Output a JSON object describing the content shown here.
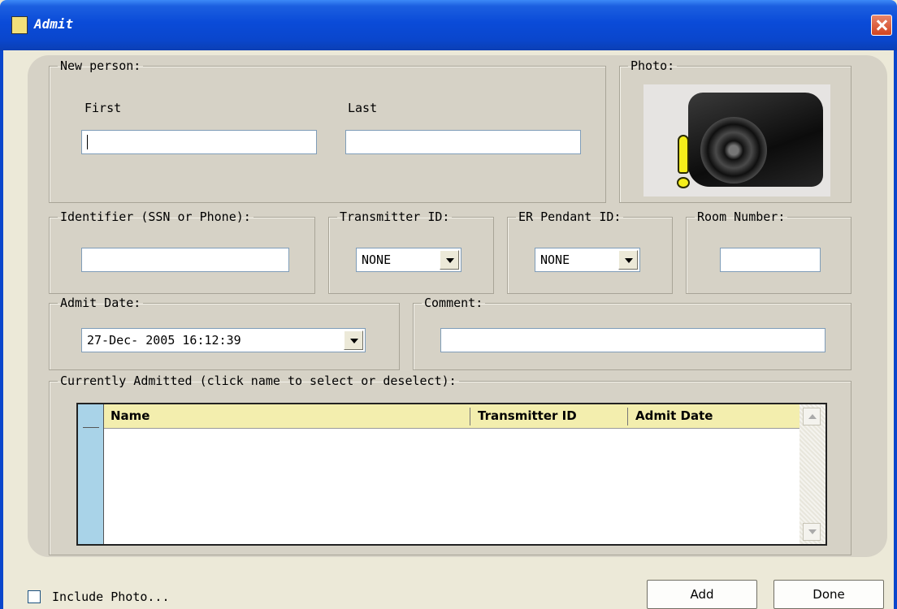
{
  "window": {
    "title": "Admit"
  },
  "new_person": {
    "legend": "New person:",
    "first_label": "First",
    "last_label": "Last",
    "first_value": "",
    "last_value": ""
  },
  "photo": {
    "legend": "Photo:",
    "icon": "camera-with-warning-icon"
  },
  "identifier": {
    "legend": "Identifier (SSN or Phone):",
    "value": ""
  },
  "transmitter": {
    "legend": "Transmitter ID:",
    "value": "NONE"
  },
  "er_pendant": {
    "legend": "ER Pendant ID:",
    "value": "NONE"
  },
  "room": {
    "legend": "Room Number:",
    "value": ""
  },
  "admit_date": {
    "legend": "Admit Date:",
    "value": "27-Dec- 2005  16:12:39"
  },
  "comment": {
    "legend": "Comment:",
    "value": ""
  },
  "admitted": {
    "legend": "Currently Admitted (click name to select or deselect):",
    "columns": [
      "Name",
      "Transmitter ID",
      "Admit Date"
    ],
    "rows": []
  },
  "footer": {
    "include_photo_label": "Include Photo...",
    "include_photo_checked": false,
    "add_label": "Add",
    "done_label": "Done"
  },
  "colors": {
    "titlebar": "#0a46cc",
    "panel": "#d6d2c6",
    "grid_header": "#f3eeae",
    "grid_rowhead": "#a9d3e8"
  }
}
